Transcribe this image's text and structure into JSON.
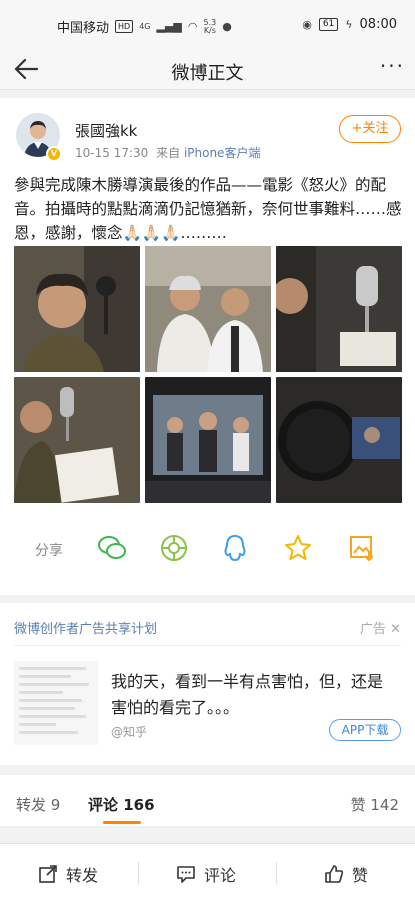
{
  "status_bar": {
    "carrier": "中国移动",
    "hd": "HD",
    "net_type": "4G",
    "speed_value": "5.3",
    "speed_unit": "K/s",
    "battery": "61",
    "time": "08:00"
  },
  "nav": {
    "title": "微博正文"
  },
  "post": {
    "username": "張國強kk",
    "time": "10-15 17:30",
    "source_prefix": "来自",
    "source_name": "iPhone客户端",
    "follow_label": "+关注",
    "text": "參與完成陳木勝導演最後的作品——電影《怒火》的配音。拍攝時的點點滴滴仍記憶猶新，奈何世事難料……感恩，感謝，懷念🙏🏻🙏🏻🙏🏻………",
    "photos": [
      {
        "icon": "photo-icon"
      },
      {
        "icon": "photo-icon"
      },
      {
        "icon": "photo-icon"
      },
      {
        "icon": "photo-icon"
      },
      {
        "icon": "photo-icon"
      },
      {
        "icon": "photo-icon"
      }
    ],
    "share_label": "分享",
    "share_targets": [
      "wechat-icon",
      "moments-icon",
      "qq-icon",
      "qzone-icon",
      "save-image-icon"
    ]
  },
  "ad": {
    "title": "微博创作者广告共享计划",
    "tag": "广告",
    "text": "我的天，看到一半有点害怕，但，还是害怕的看完了。。。",
    "source": "@知乎",
    "button": "APP下载"
  },
  "tabs": {
    "repost_label": "转发",
    "repost_count": "9",
    "comment_label": "评论",
    "comment_count": "166",
    "like_label": "赞",
    "like_count": "142"
  },
  "bottom_bar": {
    "repost": "转发",
    "comment": "评论",
    "like": "赞"
  },
  "colors": {
    "accent": "#ff8200",
    "link": "#5a7fb5",
    "background": "#f2f2f2"
  }
}
